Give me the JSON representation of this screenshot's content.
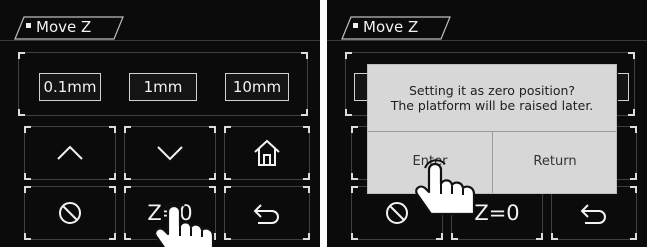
{
  "left_screen": {
    "title": "Move Z",
    "steps": [
      "0.1mm",
      "1mm",
      "10mm"
    ],
    "buttons": {
      "up": "chevron-up-icon",
      "down": "chevron-down-icon",
      "home": "home-icon",
      "stop": "stop-icon",
      "zero_label": "Z=0",
      "back": "return-icon"
    }
  },
  "right_screen": {
    "title": "Move Z",
    "zero_label": "Z=0",
    "dialog": {
      "line1": "Setting it as zero position?",
      "line2": "The platform will be raised later.",
      "enter": "Enter",
      "return": "Return"
    }
  },
  "colors": {
    "background": "#0b0b0b",
    "text": "#f2f2f2",
    "dialog": "#d7d7d7"
  }
}
